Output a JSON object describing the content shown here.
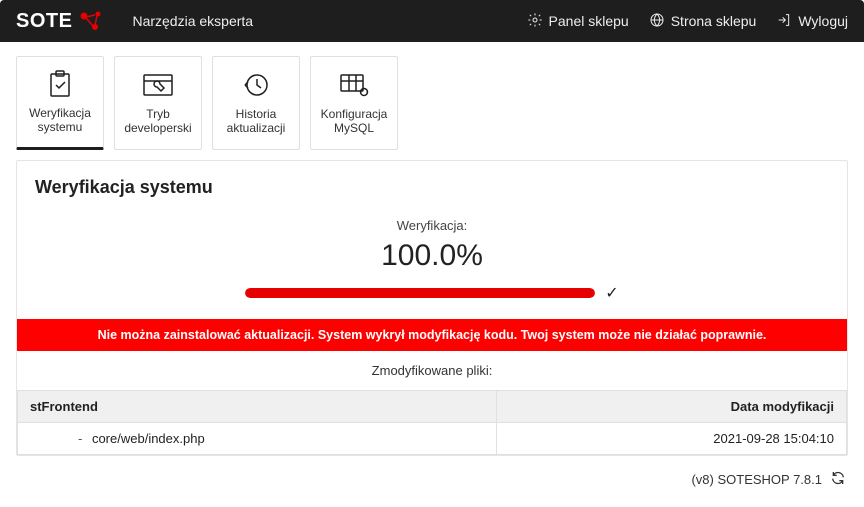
{
  "topbar": {
    "brand": "SOTE",
    "title": "Narzędzia eksperta",
    "links": {
      "panel": "Panel sklepu",
      "store": "Strona sklepu",
      "logout": "Wyloguj"
    }
  },
  "tabs": {
    "verify": "Weryfikacja systemu",
    "dev": "Tryb developerski",
    "history": "Historia aktualizacji",
    "mysql": "Konfiguracja MySQL"
  },
  "panel": {
    "heading": "Weryfikacja systemu",
    "verify_label": "Weryfikacja:",
    "percent": "100.0%",
    "progress_pct": 100,
    "alert": "Nie można zainstalować aktualizacji. System wykrył modyfikację kodu. Twoj system może nie działać poprawnie.",
    "modfiles_label": "Zmodyfikowane pliki:",
    "table": {
      "col_group": "stFrontend",
      "col_date": "Data modyfikacji",
      "rows": [
        {
          "file": "core/web/index.php",
          "date": "2021-09-28 15:04:10"
        }
      ]
    }
  },
  "footer": {
    "version": "(v8) SOTESHOP 7.8.1"
  }
}
